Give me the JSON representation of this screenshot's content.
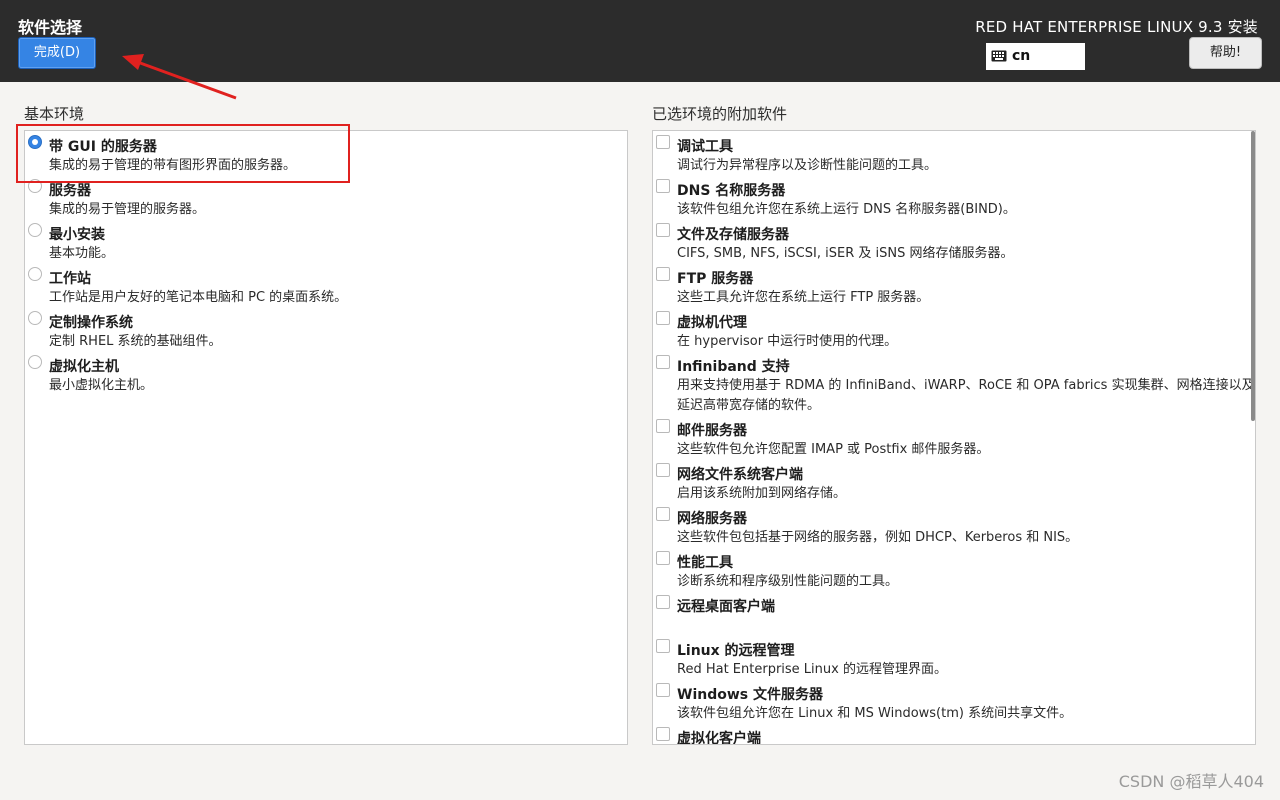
{
  "header": {
    "page_title": "软件选择",
    "done_label": "完成(D)",
    "product_title": "RED HAT ENTERPRISE LINUX 9.3 安装",
    "keyboard_layout": "cn",
    "help_label": "帮助!"
  },
  "left": {
    "section_title": "基本环境",
    "environments": [
      {
        "title": "带 GUI 的服务器",
        "desc": "集成的易于管理的带有图形界面的服务器。",
        "selected": true
      },
      {
        "title": "服务器",
        "desc": "集成的易于管理的服务器。",
        "selected": false
      },
      {
        "title": "最小安装",
        "desc": "基本功能。",
        "selected": false
      },
      {
        "title": "工作站",
        "desc": "工作站是用户友好的笔记本电脑和 PC 的桌面系统。",
        "selected": false
      },
      {
        "title": "定制操作系统",
        "desc": "定制 RHEL 系统的基础组件。",
        "selected": false
      },
      {
        "title": "虚拟化主机",
        "desc": "最小虚拟化主机。",
        "selected": false
      }
    ]
  },
  "right": {
    "section_title": "已选环境的附加软件",
    "addons": [
      {
        "title": "调试工具",
        "desc": "调试行为异常程序以及诊断性能问题的工具。",
        "checked": false
      },
      {
        "title": "DNS 名称服务器",
        "desc": "该软件包组允许您在系统上运行 DNS 名称服务器(BIND)。",
        "checked": false
      },
      {
        "title": "文件及存储服务器",
        "desc": "CIFS, SMB, NFS, iSCSI, iSER 及 iSNS 网络存储服务器。",
        "checked": false
      },
      {
        "title": "FTP 服务器",
        "desc": "这些工具允许您在系统上运行 FTP 服务器。",
        "checked": false
      },
      {
        "title": "虚拟机代理",
        "desc": "在 hypervisor 中运行时使用的代理。",
        "checked": false
      },
      {
        "title": "Infiniband 支持",
        "desc": "用来支持使用基于 RDMA 的 InfiniBand、iWARP、RoCE 和 OPA fabrics 实现集群、网格连接以及低",
        "desc2": "延迟高带宽存储的软件。",
        "checked": false
      },
      {
        "title": "邮件服务器",
        "desc": "这些软件包允许您配置 IMAP 或 Postfix 邮件服务器。",
        "checked": false
      },
      {
        "title": "网络文件系统客户端",
        "desc": "启用该系统附加到网络存储。",
        "checked": false
      },
      {
        "title": "网络服务器",
        "desc": "这些软件包包括基于网络的服务器，例如 DHCP、Kerberos 和 NIS。",
        "checked": false
      },
      {
        "title": "性能工具",
        "desc": "诊断系统和程序级别性能问题的工具。",
        "checked": false
      },
      {
        "title": "远程桌面客户端",
        "desc": "",
        "checked": false
      },
      {
        "title": "Linux 的远程管理",
        "desc": "Red Hat Enterprise Linux 的远程管理界面。",
        "checked": false
      },
      {
        "title": "Windows 文件服务器",
        "desc": "该软件包组允许您在 Linux 和 MS Windows(tm) 系统间共享文件。",
        "checked": false
      },
      {
        "title": "虚拟化客户端",
        "desc": "",
        "checked": false
      }
    ]
  },
  "watermark": "CSDN @稻草人404",
  "colors": {
    "header_bg": "#2c2c2c",
    "accent": "#3584e4",
    "annotation": "#e0211f"
  }
}
